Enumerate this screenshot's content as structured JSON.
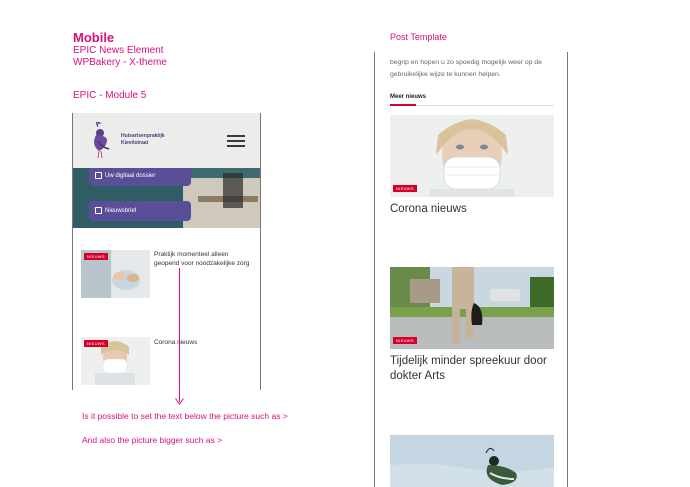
{
  "labels": {
    "mobile": "Mobile",
    "epic": "EPIC News Element",
    "wpbakery": "WPBakery  -  X-theme",
    "module": "EPIC - Module 5",
    "post_template": "Post Template"
  },
  "phone": {
    "logo_line1": "Huisartsenpraktijk",
    "logo_line2": "Kievitstraat",
    "hero_buttons": [
      "Uw digitaal dossier",
      "Nieuwsbrief"
    ],
    "items": [
      {
        "badge": "NIEUWS",
        "title": "Praktijk momenteel alleen geopend voor noodzakelijke zorg"
      },
      {
        "badge": "NIEUWS",
        "title": "Corona nieuws"
      }
    ]
  },
  "notes": {
    "line1": "Is it possible to set the text below the picture such as   >",
    "line2": "And also the picture bigger such as >"
  },
  "post": {
    "intro": "begrip en hopen u zo spoedig mogelijk weer op de gebruikelijke wijze te kunnen helpen.",
    "meer": "Meer nieuws",
    "items": [
      {
        "badge": "NIEUWS",
        "title": "Corona nieuws"
      },
      {
        "badge": "NIEUWS",
        "title": "Tijdelijk minder spreekuur door dokter Arts"
      }
    ]
  },
  "colors": {
    "accent": "#d6127a",
    "badge": "#d6002a",
    "brand": "#5a4e98"
  }
}
